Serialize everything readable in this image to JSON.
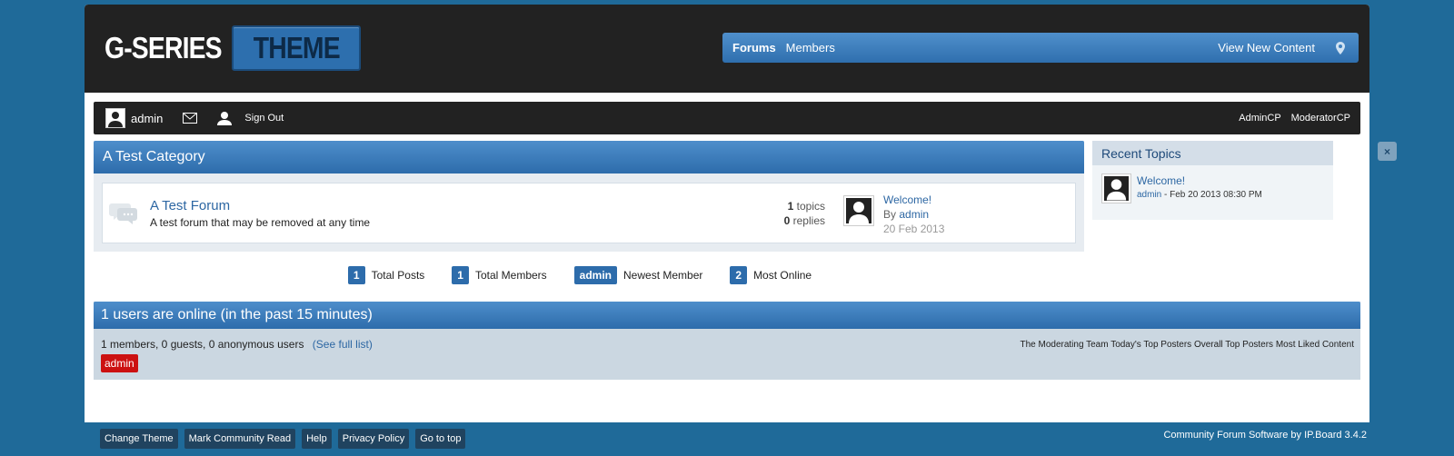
{
  "logo": {
    "part1": "G-SERIES",
    "part2": "THEME"
  },
  "nav": {
    "forums": "Forums",
    "members": "Members",
    "view_new": "View New Content",
    "location_icon": "map-pin-icon"
  },
  "userbar": {
    "username": "admin",
    "sign_out": "Sign Out",
    "admin_cp": "AdminCP",
    "moderator_cp": "ModeratorCP"
  },
  "category": {
    "title": "A Test Category",
    "forum": {
      "title": "A Test Forum",
      "description": "A test forum that may be removed at any time",
      "topics_count": "1",
      "topics_label": "topics",
      "replies_count": "0",
      "replies_label": "replies",
      "last_post_title": "Welcome!",
      "last_post_by": "By",
      "last_post_author": "admin",
      "last_post_date": "20 Feb 2013"
    }
  },
  "sidebar": {
    "title": "Recent Topics",
    "topic_title": "Welcome!",
    "topic_author": "admin",
    "topic_date": "- Feb 20 2013 08:30 PM"
  },
  "close_label": "×",
  "stats": {
    "total_posts_value": "1",
    "total_posts_label": "Total Posts",
    "total_members_value": "1",
    "total_members_label": "Total Members",
    "newest_member_value": "admin",
    "newest_member_label": "Newest Member",
    "most_online_value": "2",
    "most_online_label": "Most Online"
  },
  "online": {
    "title": "1 users are online (in the past 15 minutes)",
    "summary": "1 members, 0 guests, 0 anonymous users",
    "see_full": "(See full list)",
    "links": [
      "The Moderating Team",
      "Today's Top Posters",
      "Overall Top Posters",
      "Most Liked Content"
    ],
    "user": "admin"
  },
  "footer": {
    "buttons": [
      "Change Theme",
      "Mark Community Read",
      "Help",
      "Privacy Policy",
      "Go to top"
    ],
    "copyright": "Community Forum Software by IP.Board 3.4.2"
  },
  "colors": {
    "brand_blue": "#2d6cab",
    "dark": "#222222",
    "page_bg": "#1f6a99",
    "online_user": "#cc1111"
  }
}
